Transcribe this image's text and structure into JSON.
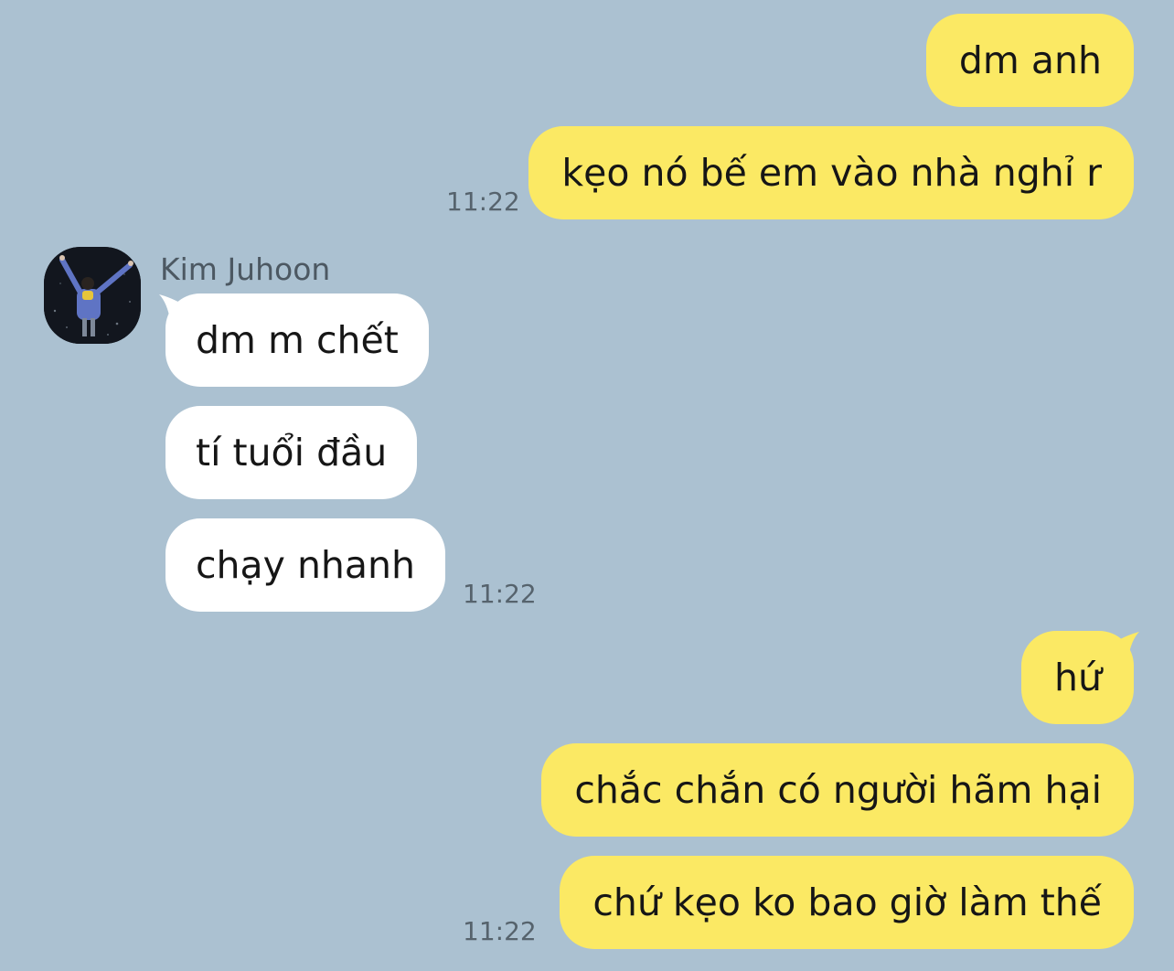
{
  "contact": {
    "name": "Kim Juhoon",
    "avatar_icon": "profile-photo"
  },
  "messages": {
    "out1": {
      "texts": [
        "dm anh",
        "kẹo nó bế em vào nhà nghỉ r"
      ],
      "time": "11:22"
    },
    "in1": {
      "texts": [
        "dm m chết",
        "tí tuổi đầu",
        "chạy nhanh"
      ],
      "time": "11:22"
    },
    "out2": {
      "texts": [
        "hứ",
        "chắc chắn có người hãm hại",
        "chứ kẹo ko bao giờ làm thế"
      ],
      "time": "11:22"
    }
  },
  "colors": {
    "background": "#abc1d1",
    "outgoing_bubble": "#fbe964",
    "incoming_bubble": "#ffffff",
    "timestamp": "#56636d"
  }
}
